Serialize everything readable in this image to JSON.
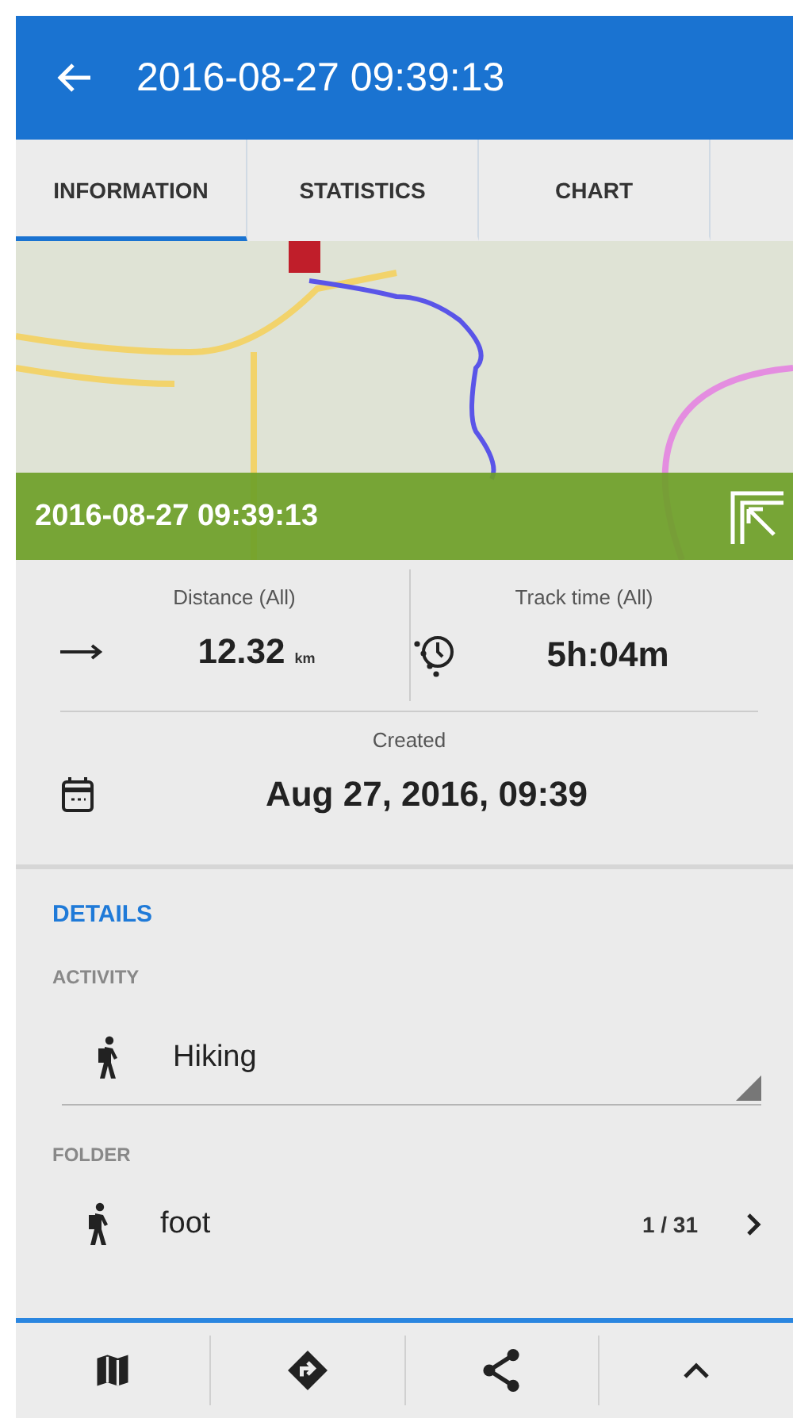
{
  "header": {
    "title": "2016-08-27 09:39:13"
  },
  "tabs": [
    {
      "label": "INFORMATION",
      "selected": true
    },
    {
      "label": "STATISTICS",
      "selected": false
    },
    {
      "label": "CHART",
      "selected": false
    }
  ],
  "map": {
    "overlay_title": "2016-08-27 09:39:13"
  },
  "stats": [
    {
      "label": "Distance (All)",
      "value": "12.32",
      "unit": "km",
      "kind": "distance"
    },
    {
      "label": "Track time (All)",
      "value": "5h:04m",
      "kind": "time"
    }
  ],
  "created": {
    "label": "Created",
    "value": "Aug 27, 2016, 09:39"
  },
  "details": {
    "heading": "DETAILS",
    "activity": {
      "label": "ACTIVITY",
      "value": "Hiking"
    },
    "folder": {
      "label": "FOLDER",
      "value": "foot",
      "count": "1 / 31"
    }
  },
  "bottom_bar": [
    {
      "kind": "map"
    },
    {
      "kind": "navigate"
    },
    {
      "kind": "share"
    },
    {
      "kind": "up"
    }
  ]
}
